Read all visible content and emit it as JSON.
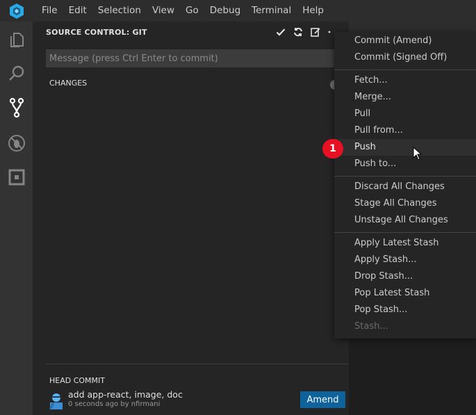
{
  "menubar": {
    "items": [
      "File",
      "Edit",
      "Selection",
      "View",
      "Go",
      "Debug",
      "Terminal",
      "Help"
    ]
  },
  "sidebar": {
    "title": "SOURCE CONTROL: GIT",
    "message_placeholder": "Message (press Ctrl Enter to commit)",
    "changes_header": "CHANGES",
    "head_commit_header": "HEAD COMMIT",
    "commit": {
      "message": "add app-react, image, doc",
      "meta": "0 seconds ago by nfirmani"
    },
    "amend_label": "Amend"
  },
  "context_menu": {
    "groups": [
      [
        "Commit (Amend)",
        "Commit (Signed Off)"
      ],
      [
        "Fetch...",
        "Merge...",
        "Pull",
        "Pull from...",
        "Push",
        "Push to..."
      ],
      [
        "Discard All Changes",
        "Stage All Changes",
        "Unstage All Changes"
      ],
      [
        "Apply Latest Stash",
        "Apply Stash...",
        "Drop Stash...",
        "Pop Latest Stash",
        "Pop Stash...",
        "Stash..."
      ]
    ],
    "hovered_item": "Push",
    "disabled_item": "Stash..."
  },
  "badge": {
    "label": "1"
  },
  "colors": {
    "accent": "#0e639c",
    "badge": "#e81123",
    "logo": "#29a9e8"
  }
}
